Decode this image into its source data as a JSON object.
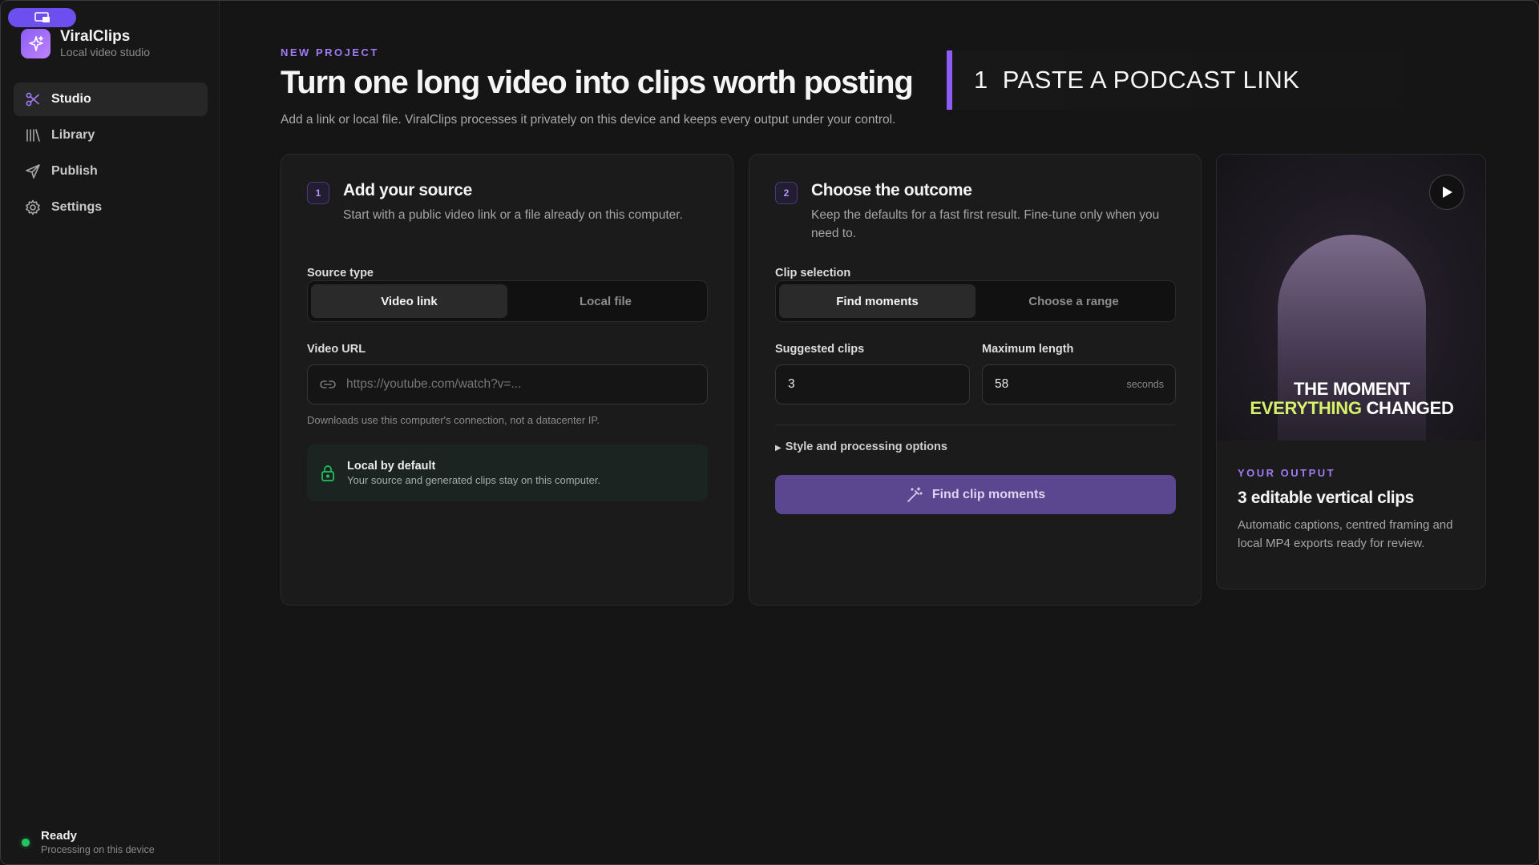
{
  "sidebar": {
    "brand_name": "ViralClips",
    "brand_sub": "Local video studio",
    "items": [
      {
        "label": "Studio",
        "icon": "scissors-icon"
      },
      {
        "label": "Library",
        "icon": "library-icon"
      },
      {
        "label": "Publish",
        "icon": "send-icon"
      },
      {
        "label": "Settings",
        "icon": "gear-icon"
      }
    ],
    "status_title": "Ready",
    "status_sub": "Processing on this device"
  },
  "header": {
    "eyebrow": "NEW PROJECT",
    "title": "Turn one long video into clips worth posting",
    "description": "Add a link or local file. ViralClips processes it privately on this device and keeps every output under your control.",
    "banner_num": "1",
    "banner_text": "PASTE A PODCAST LINK"
  },
  "source_card": {
    "step": "1",
    "title": "Add your source",
    "description": "Start with a public video link or a file already on this computer.",
    "source_type_label": "Source type",
    "options": [
      "Video link",
      "Local file"
    ],
    "url_label": "Video URL",
    "url_placeholder": "https://youtube.com/watch?v=...",
    "hint": "Downloads use this computer's connection, not a datacenter IP.",
    "local_title": "Local by default",
    "local_sub": "Your source and generated clips stay on this computer."
  },
  "outcome_card": {
    "step": "2",
    "title": "Choose the outcome",
    "description": "Keep the defaults for a fast first result. Fine-tune only when you need to.",
    "selection_label": "Clip selection",
    "options": [
      "Find moments",
      "Choose a range"
    ],
    "suggested_label": "Suggested clips",
    "suggested_value": "3",
    "max_label": "Maximum length",
    "max_value": "58",
    "max_unit": "seconds",
    "disclosure": "Style and processing options",
    "button": "Find clip moments"
  },
  "preview": {
    "caption_line1": "THE MOMENT",
    "caption_hl": "EVERYTHING",
    "caption_rest": "CHANGED",
    "eyebrow": "YOUR OUTPUT",
    "title": "3 editable vertical clips",
    "description": "Automatic captions, centred framing and local MP4 exports ready for review."
  },
  "colors": {
    "accent": "#8b5cf6",
    "button": "#5b4790",
    "status_ready": "#22c55e",
    "caption_highlight": "#d7f26a"
  }
}
